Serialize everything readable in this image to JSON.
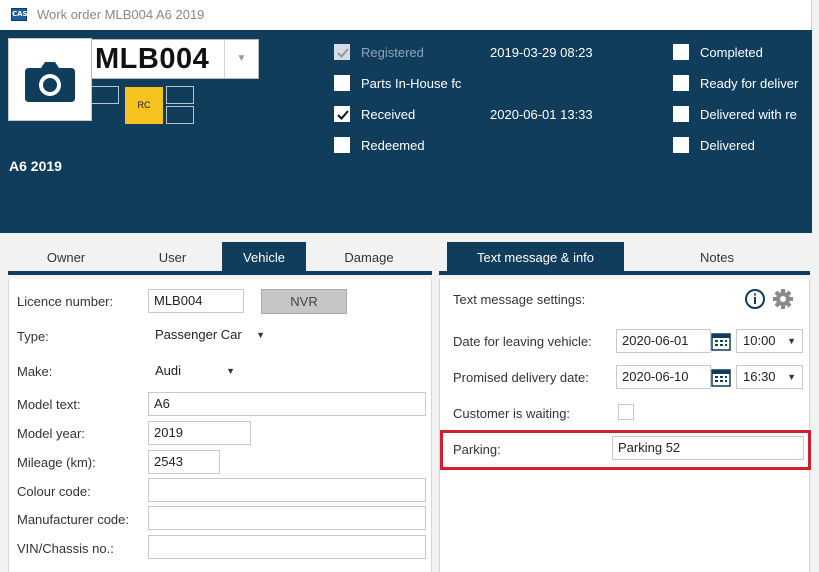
{
  "window": {
    "title": "Work order MLB004 A6 2019",
    "app_icon_text": "CAS"
  },
  "header": {
    "registration": "MLB004",
    "rc_badge": "RC",
    "model": "A6 2019",
    "status_left": [
      {
        "label": "Registered",
        "checked": true,
        "disabled": true,
        "date": "2019-03-29 08:23"
      },
      {
        "label": "Parts In-House fc",
        "checked": false,
        "disabled": false,
        "date": ""
      },
      {
        "label": "Received",
        "checked": true,
        "disabled": false,
        "date": "2020-06-01 13:33"
      },
      {
        "label": "Redeemed",
        "checked": false,
        "disabled": false,
        "date": ""
      }
    ],
    "status_right": [
      {
        "label": "Completed",
        "checked": false
      },
      {
        "label": "Ready for deliver",
        "checked": false
      },
      {
        "label": "Delivered with re",
        "checked": false
      },
      {
        "label": "Delivered",
        "checked": false
      }
    ]
  },
  "tabs_left": [
    "Owner",
    "User",
    "Vehicle",
    "Damage"
  ],
  "tabs_right": [
    "Text message & info",
    "Notes"
  ],
  "vehicle": {
    "licence_label": "Licence number:",
    "licence_value": "MLB004",
    "nvr_button": "NVR",
    "type_label": "Type:",
    "type_value": "Passenger Car",
    "make_label": "Make:",
    "make_value": "Audi",
    "model_text_label": "Model text:",
    "model_text_value": "A6",
    "model_year_label": "Model year:",
    "model_year_value": "2019",
    "mileage_label": "Mileage (km):",
    "mileage_value": "2543",
    "colour_label": "Colour code:",
    "colour_value": "",
    "manufacturer_label": "Manufacturer code:",
    "manufacturer_value": "",
    "vin_label": "VIN/Chassis no.:",
    "vin_value": ""
  },
  "info": {
    "settings_label": "Text message settings:",
    "leaving_label": "Date for leaving vehicle:",
    "leaving_date": "2020-06-01",
    "leaving_time": "10:00",
    "promised_label": "Promised delivery date:",
    "promised_date": "2020-06-10",
    "promised_time": "16:30",
    "waiting_label": "Customer is waiting:",
    "parking_label": "Parking:",
    "parking_value": "Parking 52"
  },
  "colors": {
    "header_bg": "#103d5c",
    "rc_yellow": "#f5c21e",
    "highlight_red": "#d11f2b"
  }
}
